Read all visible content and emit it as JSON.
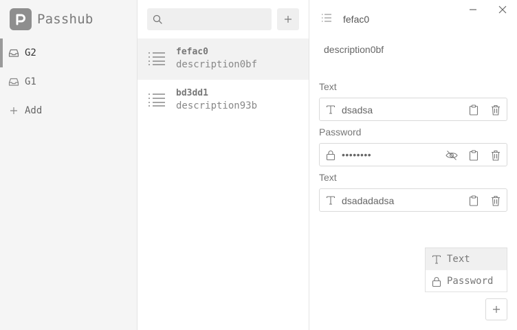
{
  "app": {
    "name": "Passhub",
    "logo_letter": "P"
  },
  "sidebar": {
    "items": [
      {
        "label": "G2",
        "icon": "inbox-icon",
        "active": true
      },
      {
        "label": "G1",
        "icon": "inbox-icon",
        "active": false
      }
    ],
    "add_label": "Add"
  },
  "list": {
    "search": {
      "placeholder": ""
    },
    "entries": [
      {
        "title": "fefac0",
        "subtitle": "description0bf",
        "active": true
      },
      {
        "title": "bd3dd1",
        "subtitle": "description93b",
        "active": false
      }
    ]
  },
  "detail": {
    "title": "fefac0",
    "description": "description0bf",
    "fields": [
      {
        "label": "Text",
        "type": "text",
        "value": "dsadsa"
      },
      {
        "label": "Password",
        "type": "password",
        "value": "••••••••"
      },
      {
        "label": "Text",
        "type": "text",
        "value": "dsadadadsa"
      }
    ],
    "add_menu": [
      {
        "label": "Text",
        "icon": "text-icon",
        "highlighted": true
      },
      {
        "label": "Password",
        "icon": "lock-icon",
        "highlighted": false
      }
    ]
  },
  "colors": {
    "accent": "#9a9a9a",
    "sidebar_bg": "#f5f5f5",
    "logo_bg": "#8e8e8e"
  }
}
